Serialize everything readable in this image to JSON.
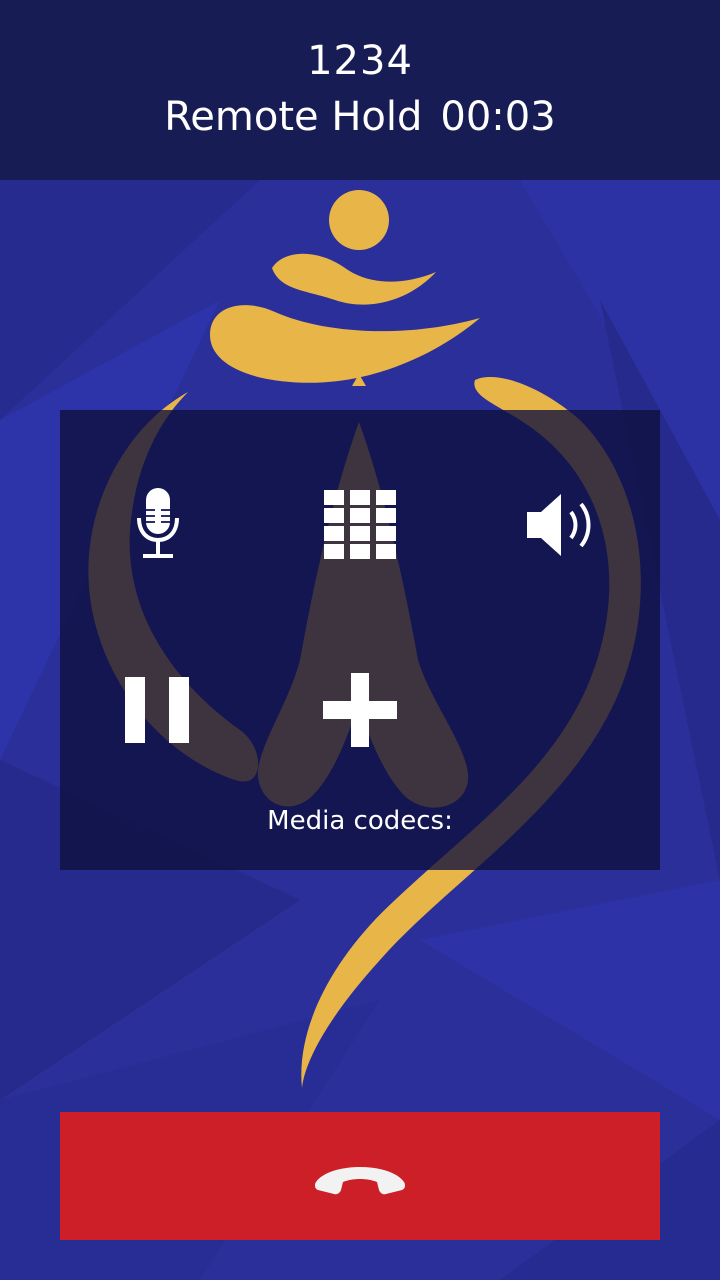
{
  "call": {
    "number": "1234",
    "state": "Remote Hold",
    "timer": "00:03"
  },
  "controls": {
    "mute_icon": "microphone-icon",
    "keypad_icon": "dialpad-icon",
    "speaker_icon": "speaker-icon",
    "hold_icon": "pause-icon",
    "add_icon": "plus-icon"
  },
  "media": {
    "codecs_label": "Media codecs:"
  },
  "hangup": {
    "icon": "end-call-icon"
  },
  "colors": {
    "background": "#2a2f9a",
    "header": "#181c55",
    "panel": "#0e103c",
    "logo_gold": "#e8b548",
    "hangup_red": "#cd1f27"
  }
}
